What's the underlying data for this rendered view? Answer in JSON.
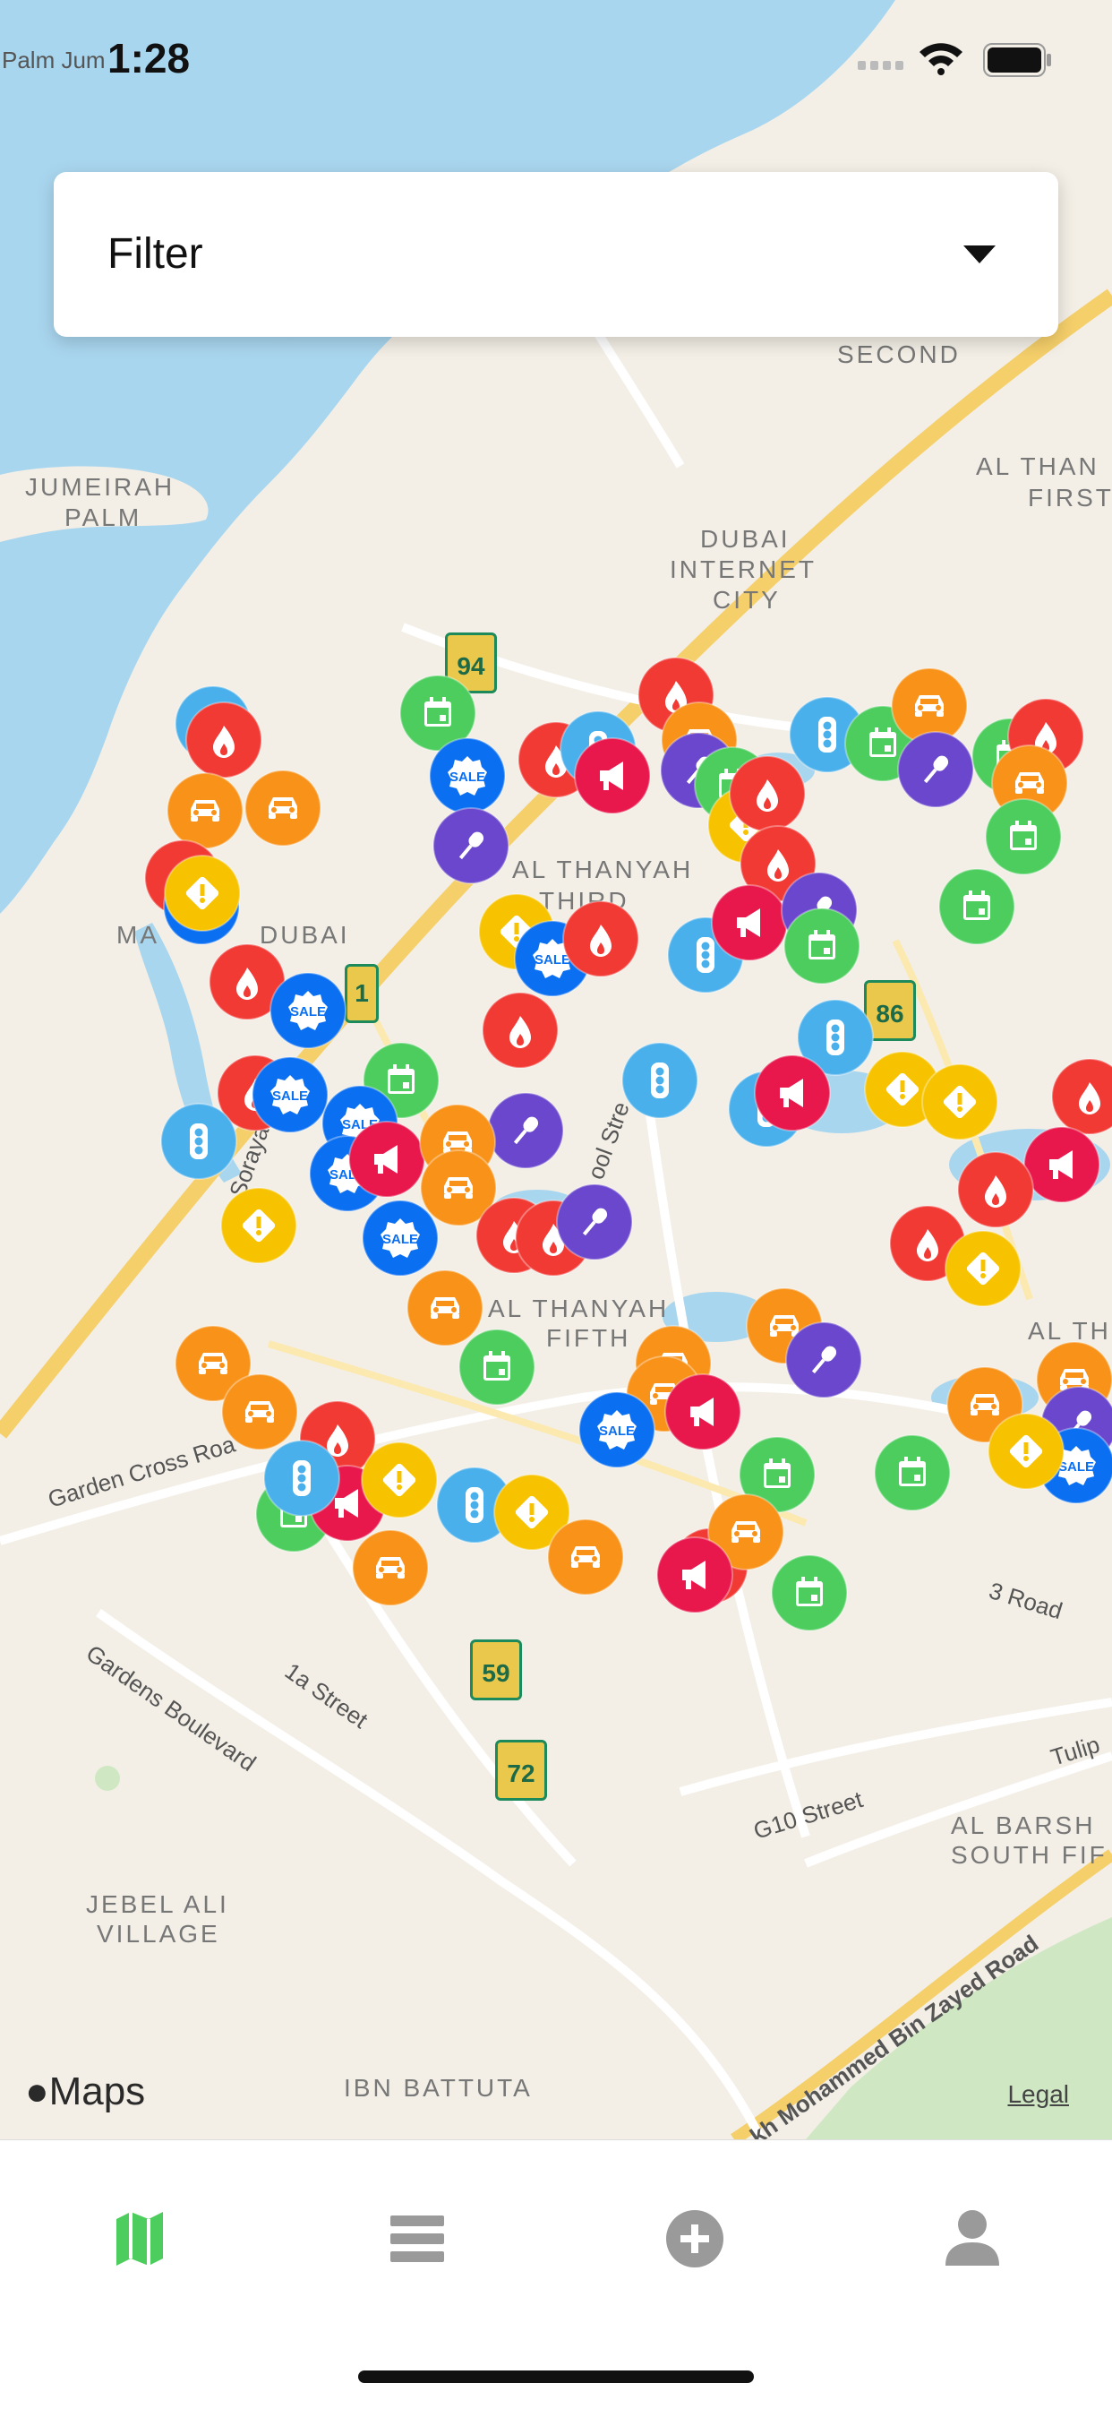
{
  "status_bar": {
    "time": "1:28"
  },
  "filter": {
    "label": "Filter"
  },
  "map": {
    "attribution": "Maps",
    "legal_link": "Legal",
    "place_labels": [
      "Palm Jum",
      "SECOND",
      "JUMEIRAH",
      "PALM",
      "DUBAI",
      "INTERNET",
      "CITY",
      "AL THAN",
      "FIRST",
      "AL THANYAH",
      "THIRD",
      "MA",
      "DUBAI",
      "AL THANYAH",
      "FIFTH",
      "AL TH",
      "AL BARSH",
      "SOUTH FIF",
      "JEBEL ALI",
      "VILLAGE",
      "IBN BATTUTA"
    ],
    "road_labels": [
      "Garden Cross Roa",
      "Gardens Boulevard",
      "1a Street",
      "G10 Street",
      "3 Road",
      "Tulip",
      "kh Mohammed Bin Zayed Road",
      "ool Stre",
      "Sorayat"
    ],
    "route_shields": [
      "94",
      "1",
      "86",
      "59",
      "72"
    ],
    "marker_types": {
      "fire": {
        "color": "#f23a35",
        "icon": "fire-icon"
      },
      "car": {
        "color": "#f89219",
        "icon": "car-icon"
      },
      "traffic": {
        "color": "#4ab0ec",
        "icon": "traffic-light-icon"
      },
      "calendar": {
        "color": "#4ccd5d",
        "icon": "calendar-icon"
      },
      "sale": {
        "color": "#0b6ff2",
        "icon": "sale-badge-icon",
        "text": "SALE"
      },
      "warning": {
        "color": "#f7c300",
        "icon": "warning-icon"
      },
      "mic": {
        "color": "#6a47cc",
        "icon": "microphone-icon"
      },
      "megaphone": {
        "color": "#e8174c",
        "icon": "megaphone-icon"
      }
    },
    "marker_count": 98
  },
  "tab_bar": {
    "tabs": [
      {
        "name": "map",
        "icon": "map-icon",
        "active": true
      },
      {
        "name": "list",
        "icon": "list-icon",
        "active": false
      },
      {
        "name": "add",
        "icon": "add-circle-icon",
        "active": false
      },
      {
        "name": "profile",
        "icon": "person-icon",
        "active": false
      }
    ],
    "active_color": "#4ccd5d",
    "inactive_color": "#9a9a9a"
  }
}
